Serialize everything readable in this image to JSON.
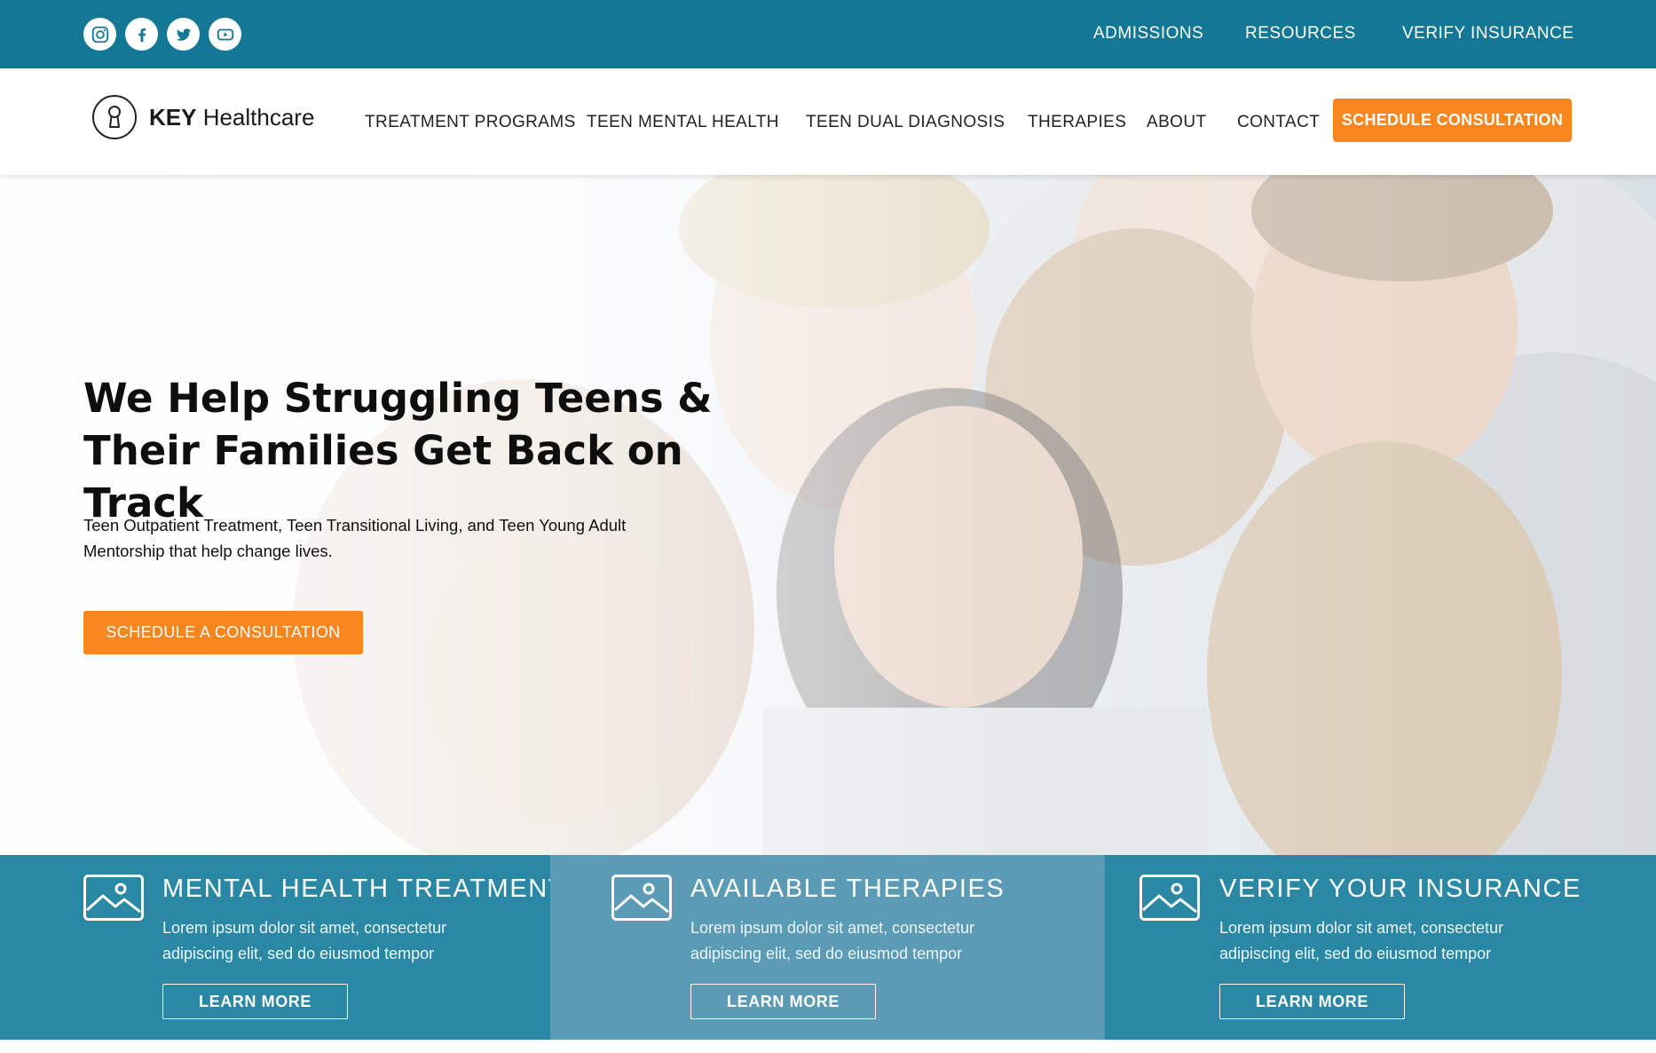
{
  "topbar": {
    "social": [
      "instagram-icon",
      "facebook-icon",
      "twitter-icon",
      "youtube-icon"
    ],
    "links": [
      "ADMISSIONS",
      "RESOURCES",
      "VERIFY INSURANCE"
    ]
  },
  "brand": {
    "bold": "KEY",
    "rest": " Healthcare",
    "icon": "keyhole-icon"
  },
  "nav": {
    "items": [
      "TREATMENT PROGRAMS",
      "TEEN MENTAL HEALTH",
      "TEEN DUAL DIAGNOSIS",
      "THERAPIES",
      "ABOUT",
      "CONTACT"
    ],
    "cta": "SCHEDULE CONSULTATION"
  },
  "hero": {
    "title": "We Help Struggling Teens & Their Families Get Back on Track",
    "subtitle": "Teen Outpatient Treatment, Teen Transitional Living, and Teen Young Adult Mentorship that help change lives.",
    "button": "SCHEDULE A CONSULTATION"
  },
  "features": [
    {
      "title": "MENTAL HEALTH TREATMENT",
      "text": "Lorem ipsum dolor sit amet, consectetur adipiscing elit, sed do eiusmod tempor",
      "button": "LEARN MORE",
      "color": "#2a88a4"
    },
    {
      "title": "AVAILABLE THERAPIES",
      "text": "Lorem ipsum dolor sit amet, consectetur adipiscing elit, sed do eiusmod tempor",
      "button": "LEARN MORE",
      "color": "#5b9bb6"
    },
    {
      "title": "VERIFY YOUR INSURANCE",
      "text": "Lorem ipsum dolor sit amet, consectetur adipiscing elit, sed do eiusmod tempor",
      "button": "LEARN MORE",
      "color": "#2a88a4"
    }
  ],
  "colors": {
    "topbar": "#137896",
    "accent": "#f7861e"
  }
}
